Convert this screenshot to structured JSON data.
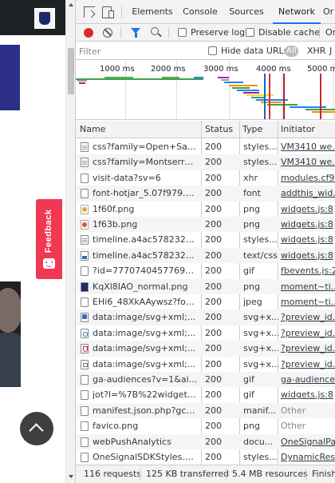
{
  "page": {
    "feedback_label": "Feedback"
  },
  "devtools": {
    "tabs": [
      {
        "label": "Elements",
        "active": false
      },
      {
        "label": "Console",
        "active": false
      },
      {
        "label": "Sources",
        "active": false
      },
      {
        "label": "Network",
        "active": true
      },
      {
        "label": "Or",
        "active": false
      }
    ],
    "toolbar": {
      "preserve_log_label": "Preserve log",
      "disable_cache_label": "Disable cache",
      "online_label": "On"
    },
    "filter": {
      "placeholder": "Filter",
      "value": "",
      "hide_data_urls_label": "Hide data URLs",
      "all_label": "All",
      "xhr_label": "XHR",
      "js_label": "J"
    },
    "overview": {
      "ticks": [
        "1000 ms",
        "2000 ms",
        "3000 ms",
        "4000 ms",
        "5000 ms"
      ]
    },
    "columns": [
      "Name",
      "Status",
      "Type",
      "Initiator"
    ],
    "requests": [
      {
        "name": "css?family=Open+Sans%...",
        "status": "200",
        "type": "styles...",
        "initiator": "VM3410 we...",
        "icon": "css"
      },
      {
        "name": "css?family=Montserrat%...",
        "status": "200",
        "type": "styles...",
        "initiator": "VM3410 we...",
        "icon": "css"
      },
      {
        "name": "visit-data?sv=6",
        "status": "200",
        "type": "xhr",
        "initiator": "modules.cf9...",
        "icon": "doc"
      },
      {
        "name": "font-hotjar_5.07f979.woff2",
        "status": "200",
        "type": "font",
        "initiator": "addthis_wid...",
        "icon": "doc"
      },
      {
        "name": "1f60f.png",
        "status": "200",
        "type": "png",
        "initiator": "widgets.js:8",
        "icon": "emoji-a"
      },
      {
        "name": "1f63b.png",
        "status": "200",
        "type": "png",
        "initiator": "widgets.js:8",
        "icon": "emoji-b"
      },
      {
        "name": "timeline.a4ac5782325ad1...",
        "status": "200",
        "type": "styles...",
        "initiator": "widgets.js:8",
        "icon": "css"
      },
      {
        "name": "timeline.a4ac5782325ad1...",
        "status": "200",
        "type": "text/css",
        "initiator": "widgets.js:8",
        "icon": "img"
      },
      {
        "name": "?id=777074045776934&...",
        "status": "200",
        "type": "gif",
        "initiator": "fbevents.js:26",
        "icon": "doc"
      },
      {
        "name": "KqXl8IAO_normal.png",
        "status": "200",
        "type": "png",
        "initiator": "moment~ti...",
        "icon": "photo"
      },
      {
        "name": "EHi6_48XkAAywsz?forma...",
        "status": "200",
        "type": "jpeg",
        "initiator": "moment~ti...",
        "icon": "doc"
      },
      {
        "name": "data:image/svg+xml;...",
        "status": "200",
        "type": "svg+x...",
        "initiator": "?preview_id...",
        "icon": "svg1"
      },
      {
        "name": "data:image/svg+xml;...",
        "status": "200",
        "type": "svg+x...",
        "initiator": "?preview_id...",
        "icon": "svg2"
      },
      {
        "name": "data:image/svg+xml;...",
        "status": "200",
        "type": "svg+x...",
        "initiator": "?preview_id...",
        "icon": "svg3"
      },
      {
        "name": "data:image/svg+xml;...",
        "status": "200",
        "type": "svg+x...",
        "initiator": "?preview_id...",
        "icon": "svg4"
      },
      {
        "name": "ga-audiences?v=1&aip=...",
        "status": "200",
        "type": "gif",
        "initiator": "ga-audiences",
        "icon": "doc"
      },
      {
        "name": "jot?l=%7B%22widget_ori...",
        "status": "200",
        "type": "gif",
        "initiator": "widgets.js:8",
        "icon": "doc"
      },
      {
        "name": "manifest.json.php?gcm_s...",
        "status": "200",
        "type": "manif...",
        "initiator": "Other",
        "icon": "doc",
        "plain": true
      },
      {
        "name": "favico.png",
        "status": "200",
        "type": "png",
        "initiator": "Other",
        "icon": "doc",
        "plain": true
      },
      {
        "name": "webPushAnalytics",
        "status": "200",
        "type": "docu...",
        "initiator": "OneSignalPa...",
        "icon": "doc"
      },
      {
        "name": "OneSignalSDKStyles.css?...",
        "status": "200",
        "type": "styles...",
        "initiator": "DynamicRes...",
        "icon": "doc"
      }
    ],
    "status_bar": {
      "requests": "116 requests",
      "transferred": "125 KB transferred",
      "resources": "5.4 MB resources",
      "finish": "Finish"
    }
  },
  "colors": {
    "record": "#d93025",
    "accent": "#1a73e8",
    "feedback": "#f03852"
  }
}
